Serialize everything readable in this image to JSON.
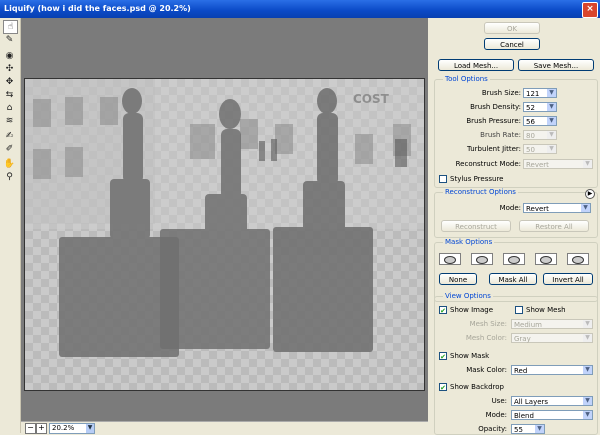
{
  "title": "Liquify (how i did the faces.psd @ 20.2%)",
  "tools": [
    "forward-warp",
    "reconstruct",
    "twirl",
    "pucker",
    "bloat",
    "push-left",
    "mirror",
    "turbulence",
    "freeze-mask",
    "thaw-mask",
    "hand",
    "zoom"
  ],
  "zoom": {
    "value": "20.2%"
  },
  "buttons": {
    "ok": "OK",
    "cancel": "Cancel",
    "load_mesh": "Load Mesh...",
    "save_mesh": "Save Mesh..."
  },
  "tool_options": {
    "title": "Tool Options",
    "brush_size": {
      "label": "Brush Size:",
      "value": "121"
    },
    "brush_density": {
      "label": "Brush Density:",
      "value": "52"
    },
    "brush_pressure": {
      "label": "Brush Pressure:",
      "value": "56"
    },
    "brush_rate": {
      "label": "Brush Rate:",
      "value": "80"
    },
    "turbulent_jitter": {
      "label": "Turbulent Jitter:",
      "value": "50"
    },
    "reconstruct_mode": {
      "label": "Reconstruct Mode:",
      "value": "Revert"
    },
    "stylus_pressure": "Stylus Pressure"
  },
  "reconstruct_options": {
    "title": "Reconstruct Options",
    "mode_label": "Mode:",
    "mode_value": "Revert",
    "reconstruct": "Reconstruct",
    "restore_all": "Restore All"
  },
  "mask_options": {
    "title": "Mask Options",
    "none": "None",
    "mask_all": "Mask All",
    "invert_all": "Invert All"
  },
  "view_options": {
    "title": "View Options",
    "show_image": "Show Image",
    "show_mesh": "Show Mesh",
    "mesh_size": {
      "label": "Mesh Size:",
      "value": "Medium"
    },
    "mesh_color": {
      "label": "Mesh Color:",
      "value": "Gray"
    },
    "show_mask": "Show Mask",
    "mask_color": {
      "label": "Mask Color:",
      "value": "Red"
    },
    "show_backdrop": "Show Backdrop",
    "use": {
      "label": "Use:",
      "value": "All Layers"
    },
    "mode": {
      "label": "Mode:",
      "value": "Blend"
    },
    "opacity": {
      "label": "Opacity:",
      "value": "55"
    }
  },
  "photo_sign": "COST",
  "colors": {
    "title_bar": "#0a49c6",
    "panel": "#ece9d8",
    "canvas_bg": "#7b7b7b",
    "accent": "#0046d5"
  }
}
